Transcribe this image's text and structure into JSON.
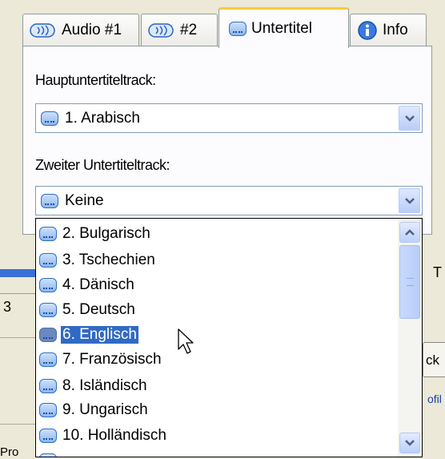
{
  "tabs": [
    {
      "label": "Audio #1",
      "icon": "audio-track-icon"
    },
    {
      "label": "#2",
      "icon": "audio-track-icon"
    },
    {
      "label": "Untertitel",
      "icon": "subtitle-icon",
      "active": true
    },
    {
      "label": "Info",
      "icon": "info-icon"
    }
  ],
  "primary": {
    "label": "Hauptuntertiteltrack:",
    "value": "1. Arabisch"
  },
  "secondary": {
    "label": "Zweiter Untertiteltrack:",
    "value": "Keine"
  },
  "dropdown": {
    "items": [
      "2. Bulgarisch",
      "3. Tschechien",
      "4. Dänisch",
      "5. Deutsch",
      "6. Englisch",
      "7. Französisch",
      "8. Isländisch",
      "9. Ungarisch",
      "10. Holländisch"
    ],
    "selected": "6. Englisch"
  },
  "background": {
    "fragment_left": "3",
    "fragment_right_ck": "ck",
    "fragment_right_ofile": "ofil",
    "fragment_right_t": "T",
    "fragment_bottom_left": "Pro"
  },
  "colors": {
    "selection": "#316ac5",
    "active_tab_accent": "#ffc73c"
  }
}
